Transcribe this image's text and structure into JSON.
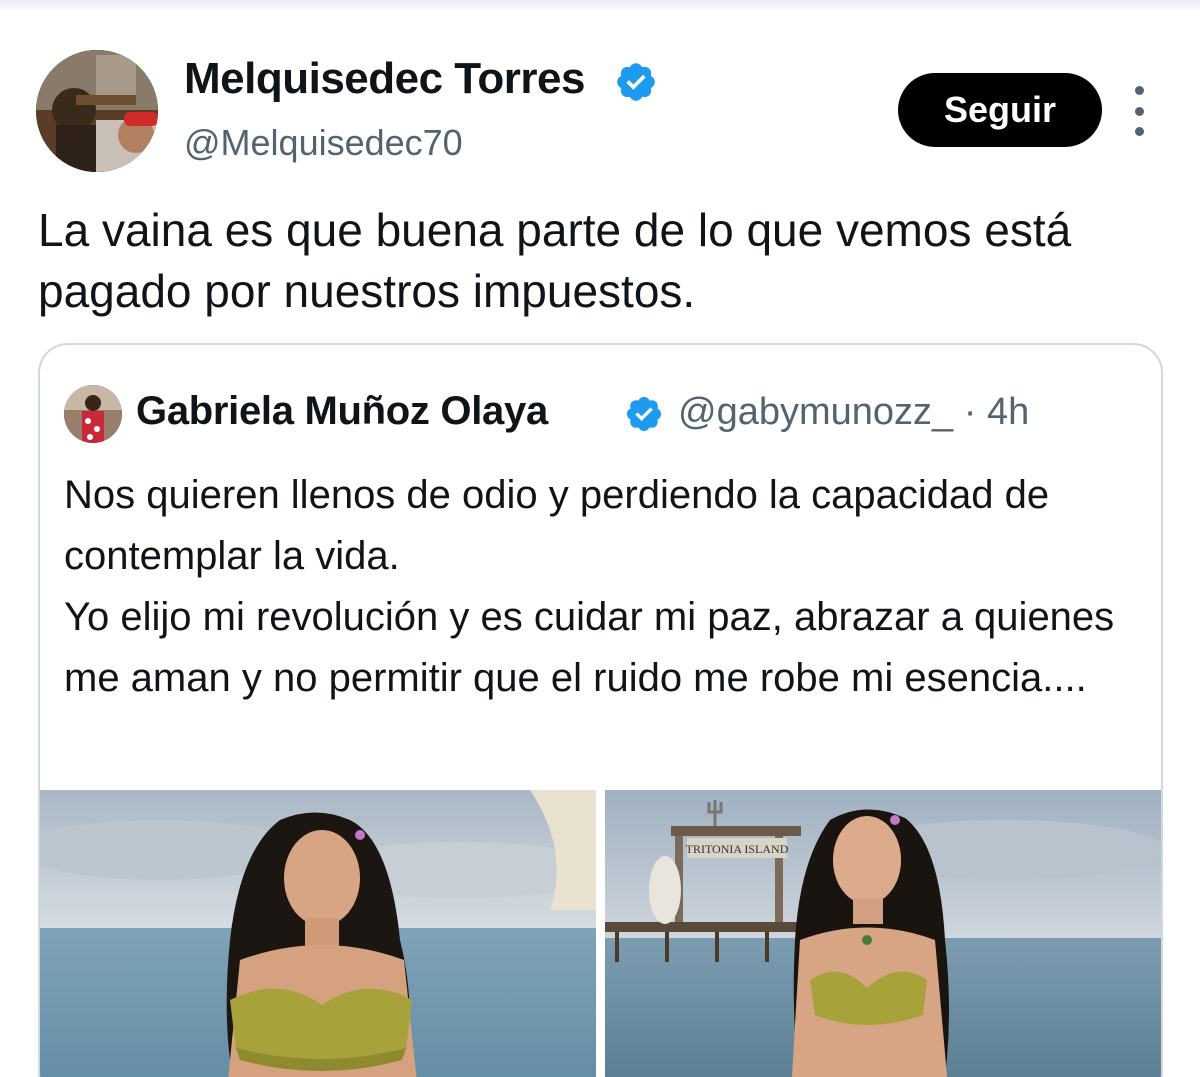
{
  "author": {
    "display_name": "Melquisedec Torres",
    "handle": "@Melquisedec70",
    "verified_icon": "verified-badge-icon",
    "avatar_icon": "profile-avatar"
  },
  "actions": {
    "follow_label": "Seguir",
    "more_icon": "more-options-icon"
  },
  "tweet": {
    "text": "La vaina es que buena parte de lo que vemos está pagado por nuestros impuestos."
  },
  "quoted": {
    "display_name": "Gabriela Muñoz Olaya",
    "handle": "@gabymunozz_",
    "separator": "·",
    "time": "4h",
    "lines": [
      "Nos quieren llenos de odio y perdiendo la capacidad de contemplar la vida.",
      "Yo elijo mi revolución y es cuidar mi paz, abrazar a quienes me aman y no permitir que el ruido me robe mi esencia...."
    ],
    "media": {
      "sign_text": "TRITONIA ISLAND"
    }
  },
  "colors": {
    "verified_blue": "#1d9bf0",
    "text_primary": "#0f1419",
    "text_secondary": "#536471",
    "border": "#cfd9de",
    "button_bg": "#000000"
  }
}
